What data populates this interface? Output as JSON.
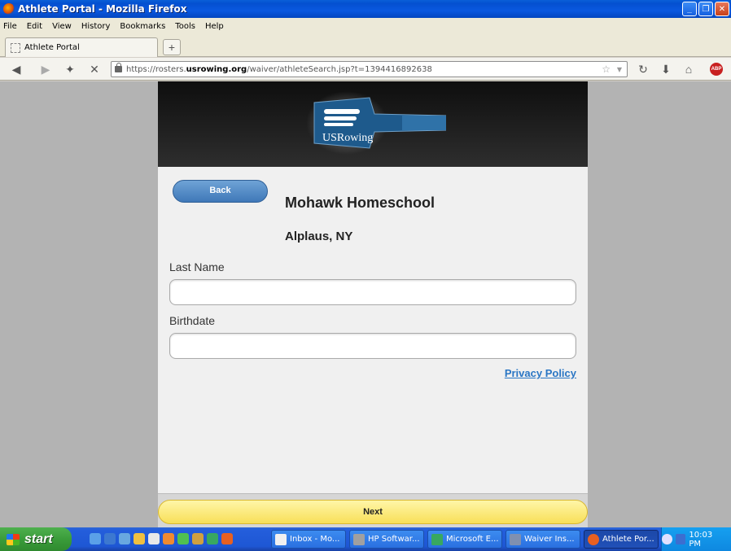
{
  "window": {
    "title": "Athlete Portal - Mozilla Firefox"
  },
  "menu": [
    "File",
    "Edit",
    "View",
    "History",
    "Bookmarks",
    "Tools",
    "Help"
  ],
  "tab": {
    "label": "Athlete Portal",
    "new_tab_label": "+"
  },
  "url": {
    "prefix": "https://rosters.",
    "domain": "usrowing.org",
    "path": "/waiver/athleteSearch.jsp?t=1394416892638"
  },
  "page": {
    "logo_text": "USRowing",
    "back_label": "Back",
    "org_name": "Mohawk Homeschool",
    "org_location": "Alplaus, NY",
    "last_name_label": "Last Name",
    "last_name_value": "",
    "birthdate_label": "Birthdate",
    "birthdate_value": "",
    "privacy_label": "Privacy Policy",
    "next_label": "Next"
  },
  "taskbar": {
    "start_label": "start",
    "tasks": [
      "Inbox - Mo...",
      "HP Softwar...",
      "Microsoft E...",
      "Waiver Ins...",
      "Athlete Por..."
    ],
    "clock": "10:03 PM"
  },
  "colors": {
    "accent": "#3f78b8",
    "next_button": "#f8df58",
    "link": "#2a76c4"
  }
}
